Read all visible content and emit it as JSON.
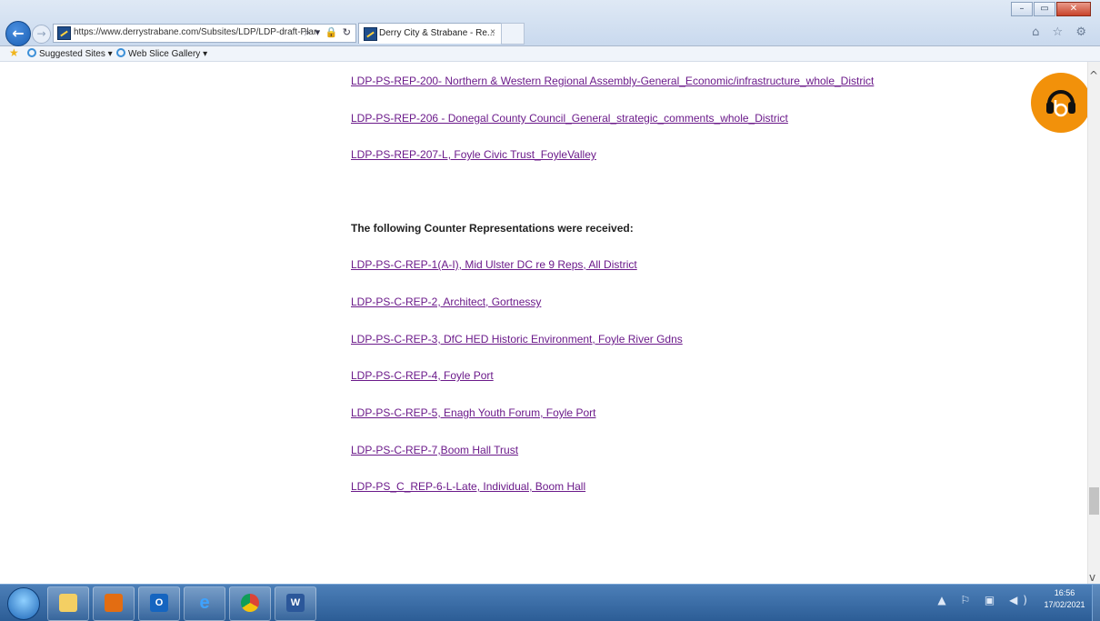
{
  "browser": {
    "url": "https://www.derrystrabane.com/Subsites/LDP/LDP-draft-Plar",
    "tab_title": "Derry City & Strabane - Re...",
    "tab_close": "×",
    "back_glyph": "←",
    "forward_glyph": "→",
    "address_icons": "⌕ ▾ 🔒 ↻",
    "right_icons": "⌂ ☆ ⚙",
    "win_minimize": "–",
    "win_maximize": "▭",
    "win_close": "✕"
  },
  "favorites": {
    "items": [
      "Suggested Sites ▾",
      "Web Slice Gallery ▾"
    ]
  },
  "page": {
    "links_top": [
      "LDP-PS-REP-200- Northern & Western Regional Assembly-General_Economic/infrastructure_whole_District",
      "LDP-PS-REP-206 - Donegal County Council_General_strategic_comments_whole_District",
      "LDP-PS-REP-207-L, Foyle Civic Trust_FoyleValley"
    ],
    "section_heading": "The following Counter Representations were received:",
    "links_counter": [
      "LDP-PS-C-REP-1(A-I), Mid Ulster DC re 9 Reps, All District",
      "LDP-PS-C-REP-2, Architect, Gortnessy",
      "LDP-PS-C-REP-3, DfC HED Historic Environment, Foyle River Gdns",
      "LDP-PS-C-REP-4, Foyle Port",
      "LDP-PS-C-REP-5, Enagh Youth Forum, Foyle Port",
      "LDP-PS-C-REP-7,Boom Hall Trust",
      "LDP-PS_C_REP-6-L-Late, Individual, Boom Hall"
    ]
  },
  "scrollbar": {
    "up": "^",
    "down": "v",
    "position_fraction": 0.86
  },
  "taskbar": {
    "apps": [
      "O",
      "W"
    ],
    "tray": "▲ ⚐ ▣ ◀)",
    "time": "16:56",
    "date": "17/02/2021"
  }
}
